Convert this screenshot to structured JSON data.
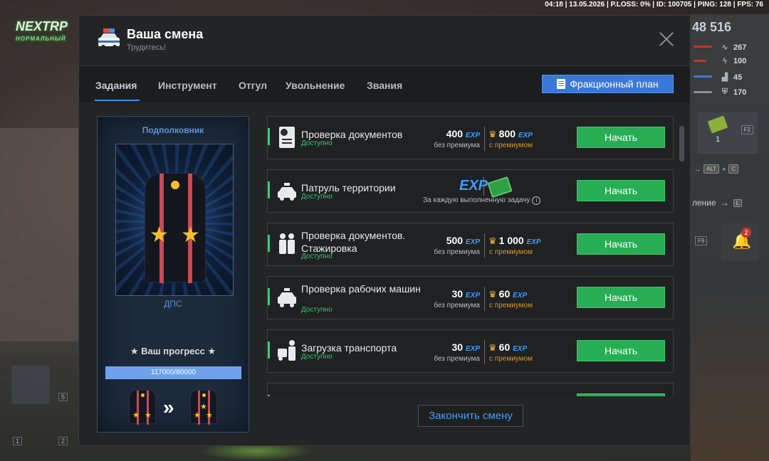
{
  "hud": {
    "top_info": "04:18 | 13.05.2026 | P.LOSS: 0% | ID: 100705 | PING: 128 | FPS: 76",
    "logo_main": "NEXTRP",
    "logo_sub": "НОРМАЛЬНЫЙ",
    "money": "48 516",
    "stats": [
      {
        "icon": "pulse-icon",
        "value": "267"
      },
      {
        "icon": "bolt-icon",
        "value": "100"
      },
      {
        "icon": "chart-icon",
        "value": "45"
      },
      {
        "icon": "shield-icon",
        "value": "170"
      }
    ],
    "slot_count": "1",
    "slot_key": "F2",
    "keys_hint": [
      "ALT",
      "C"
    ],
    "hint_text": "ление",
    "hint_key": "L",
    "bell_key": "F9",
    "bell_badge": "2",
    "left_slot_keys": [
      "5",
      "1",
      "2"
    ]
  },
  "modal": {
    "title": "Ваша смена",
    "subtitle": "Трудитесь!",
    "tabs": [
      "Задания",
      "Инструмент",
      "Отгул",
      "Увольнение",
      "Звания"
    ],
    "faction_button": "Фракционный план",
    "rank": {
      "name": "Подполковник",
      "division": "ДПС",
      "progress_label": "★ Ваш прогресс ★",
      "progress_text": "117000/80000",
      "progress_fraction": 1.0
    },
    "tasks": [
      {
        "name": "Проверка документов",
        "status": "Доступно",
        "base": "400",
        "premium": "800",
        "base_label": "без премиума",
        "premium_label": "с премиумом",
        "button": "Начать",
        "exp": "EXP"
      },
      {
        "name": "Патруль территории",
        "status": "Доступно",
        "each_label": "За каждую выполненную задачу",
        "exp": "EXP",
        "button": "Начать"
      },
      {
        "name": "Проверка документов. Стажировка",
        "status": "Доступно",
        "base": "500",
        "premium": "1 000",
        "base_label": "без премиума",
        "premium_label": "с премиумом",
        "button": "Начать",
        "exp": "EXP"
      },
      {
        "name": "Проверка рабочих машин",
        "status": "Доступно",
        "base": "30",
        "premium": "60",
        "base_label": "без премиума",
        "premium_label": "с премиумом",
        "button": "Начать",
        "exp": "EXP"
      },
      {
        "name": "Загрузка транспорта",
        "status": "Доступно",
        "base": "30",
        "premium": "60",
        "base_label": "без премиума",
        "premium_label": "с премиумом",
        "button": "Начать",
        "exp": "EXP"
      }
    ],
    "finish_button": "Закончить смену"
  }
}
